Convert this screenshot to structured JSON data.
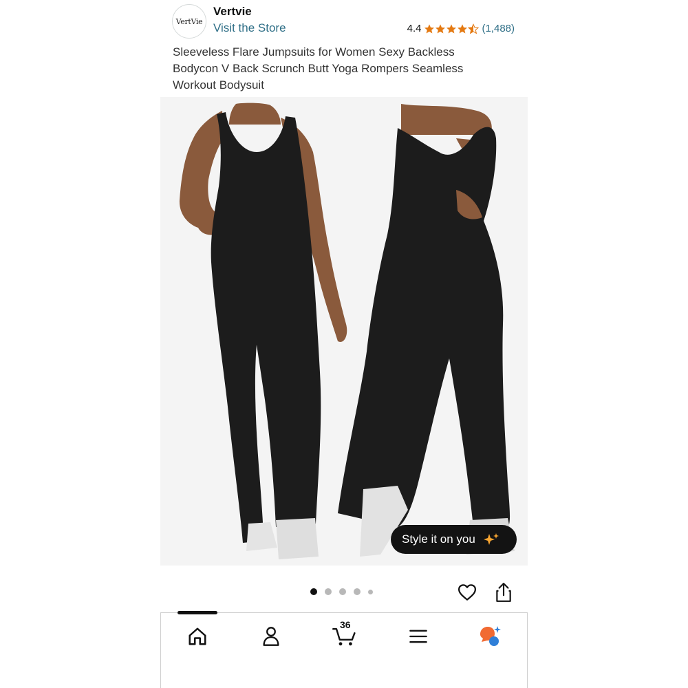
{
  "header": {
    "store_logo_text": "VertVie",
    "store_name": "Vertvie",
    "visit_store": "Visit the Store",
    "rating_score": "4.4",
    "rating_count": "(1,488)",
    "star_rating": 4.4,
    "star_color": "#e47911"
  },
  "product": {
    "title": "Sleeveless Flare Jumpsuits for Women Sexy Backless Bodycon V Back Scrunch Butt Yoga Rompers Seamless Workout Bodysuit",
    "image_description_icon": "product-photo",
    "style_button_label": "Style it on you"
  },
  "carousel": {
    "total_dots": 5,
    "active_index": 0
  },
  "actions": {
    "wishlist_icon": "heart-icon",
    "share_icon": "share-icon"
  },
  "bottom_nav": {
    "items": [
      "home-icon",
      "account-icon",
      "cart-icon",
      "menu-icon",
      "assistant-icon"
    ],
    "cart_count": "36",
    "active_index": 0
  }
}
